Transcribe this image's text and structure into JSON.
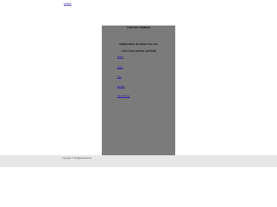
{
  "header": {
    "top_link": "GitHub"
  },
  "panel": {
    "title": "Luis Dev Student",
    "tagline_1": "Independent developer for now",
    "tagline_2": "I also learn python and html",
    "nav": [
      {
        "label": "Home"
      },
      {
        "label": "about"
      },
      {
        "label": "Test"
      },
      {
        "label": "Results"
      },
      {
        "label": "My Portfolio"
      }
    ]
  },
  "footer": {
    "copyright": "Copyright © All Rights Reserved"
  },
  "colors": {
    "panel_bg": "#7b7b7b",
    "footer_bg": "#e6e6e6",
    "link": "#1a0dab"
  }
}
